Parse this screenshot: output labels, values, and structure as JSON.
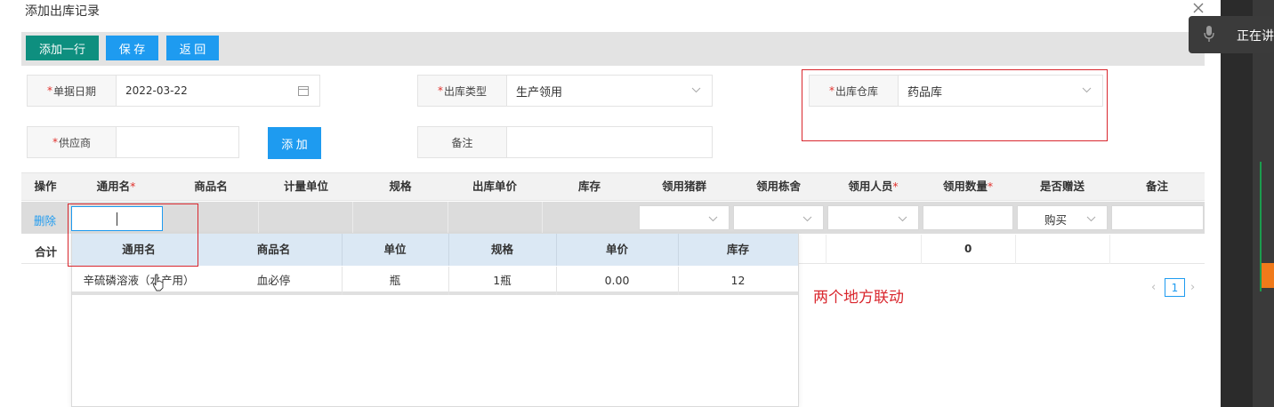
{
  "dialog": {
    "title": "添加出库记录"
  },
  "toolbar": {
    "add_row": "添加一行",
    "save": "保 存",
    "back": "返 回"
  },
  "form": {
    "doc_date": {
      "label": "单据日期",
      "value": "2022-03-22"
    },
    "out_type": {
      "label": "出库类型",
      "value": "生产领用"
    },
    "warehouse": {
      "label": "出库仓库",
      "value": "药品库"
    },
    "supplier": {
      "label": "供应商",
      "value": ""
    },
    "add_button": "添 加",
    "remark": {
      "label": "备注",
      "value": ""
    }
  },
  "table": {
    "headers": [
      "操作",
      "通用名",
      "商品名",
      "计量单位",
      "规格",
      "出库单价",
      "库存",
      "领用猪群",
      "领用栋舍",
      "领用人员",
      "领用数量",
      "是否赠送",
      "备注"
    ],
    "required_mark": "*",
    "row": {
      "delete": "删除",
      "gift_value": "购买"
    },
    "summary": {
      "label": "合计",
      "qty_total": "0"
    }
  },
  "dropdown": {
    "headers": [
      "通用名",
      "商品名",
      "单位",
      "规格",
      "单价",
      "库存"
    ],
    "rows": [
      [
        "辛硫磷溶液（水产用）",
        "血必停",
        "瓶",
        "1瓶",
        "0.00",
        "12"
      ]
    ]
  },
  "annotation": "两个地方联动",
  "pager": {
    "prev": "‹",
    "page": "1",
    "next": "›"
  },
  "meeting": {
    "status": "正在讲"
  },
  "colors": {
    "accent": "#1e9bf0",
    "teal": "#0e8f7f",
    "highlight": "#d9272e"
  }
}
